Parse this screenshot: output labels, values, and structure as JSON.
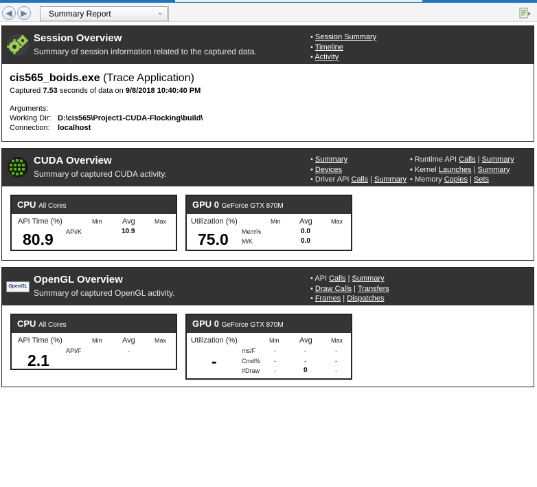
{
  "toolbar": {
    "report_select": "Summary Report"
  },
  "session": {
    "title": "Session Overview",
    "subtitle": "Summary of session information related to the captured data.",
    "links": [
      "Session Summary",
      "Timeline",
      "Activity"
    ],
    "app_exe": "cis565_boids.exe",
    "app_kind": "(Trace Application)",
    "captured_prefix": "Captured",
    "captured_seconds": "7.53",
    "captured_mid": "seconds of data on",
    "captured_date": "9/8/2018 10:40:40 PM",
    "arguments_label": "Arguments:",
    "workdir_label": "Working Dir:",
    "workdir_value": "D:\\cis565\\Project1-CUDA-Flocking\\build\\",
    "connection_label": "Connection:",
    "connection_value": "localhost"
  },
  "cuda": {
    "title": "CUDA Overview",
    "subtitle": "Summary of captured CUDA activity.",
    "links_left": {
      "summary": "Summary",
      "devices": "Devices",
      "driver_api": "Driver API",
      "driver_calls": "Calls",
      "driver_summary": "Summary"
    },
    "links_right": {
      "runtime_api": "Runtime API",
      "runtime_calls": "Calls",
      "runtime_summary": "Summary",
      "kernel": "Kernel",
      "kernel_launches": "Launches",
      "kernel_summary": "Summary",
      "memory": "Memory",
      "memory_copies": "Copies",
      "memory_sets": "Sets"
    },
    "cpu": {
      "head": "CPU",
      "head_sub": "All Cores",
      "label": "API Time (%)",
      "min": "Min",
      "avg": "Avg",
      "max": "Max",
      "big": "80.9",
      "row1_label": "API/K",
      "row1_avg": "10.9"
    },
    "gpu": {
      "head": "GPU 0",
      "head_sub": "GeForce GTX 870M",
      "label": "Utilization (%)",
      "min": "Min",
      "avg": "Avg",
      "max": "Max",
      "big": "75.0",
      "row1_label": "Mem%",
      "row1_avg": "0.0",
      "row2_label": "M/K",
      "row2_avg": "0.0"
    }
  },
  "opengl": {
    "title": "OpenGL Overview",
    "subtitle": "Summary of captured OpenGL activity.",
    "links": {
      "api": "API",
      "api_calls": "Calls",
      "api_summary": "Summary",
      "draw_calls": "Draw Calls",
      "transfers": "Transfers",
      "frames": "Frames",
      "dispatches": "Dispatches"
    },
    "logo_text": "OpenGL",
    "cpu": {
      "head": "CPU",
      "head_sub": "All Cores",
      "label": "API Time (%)",
      "min": "Min",
      "avg": "Avg",
      "max": "Max",
      "big": "2.1",
      "row1_label": "API/F",
      "row1_avg": "-"
    },
    "gpu": {
      "head": "GPU 0",
      "head_sub": "GeForce GTX 870M",
      "label": "Utilization (%)",
      "min": "Min",
      "avg": "Avg",
      "max": "Max",
      "big": "-",
      "rows": [
        {
          "label": "ms/F",
          "min": "-",
          "avg": "-",
          "max": "-"
        },
        {
          "label": "Cmd%",
          "min": "-",
          "avg": "-",
          "max": "-"
        },
        {
          "label": "#Draw",
          "min": "-",
          "avg": "0",
          "max": "-"
        }
      ]
    }
  }
}
